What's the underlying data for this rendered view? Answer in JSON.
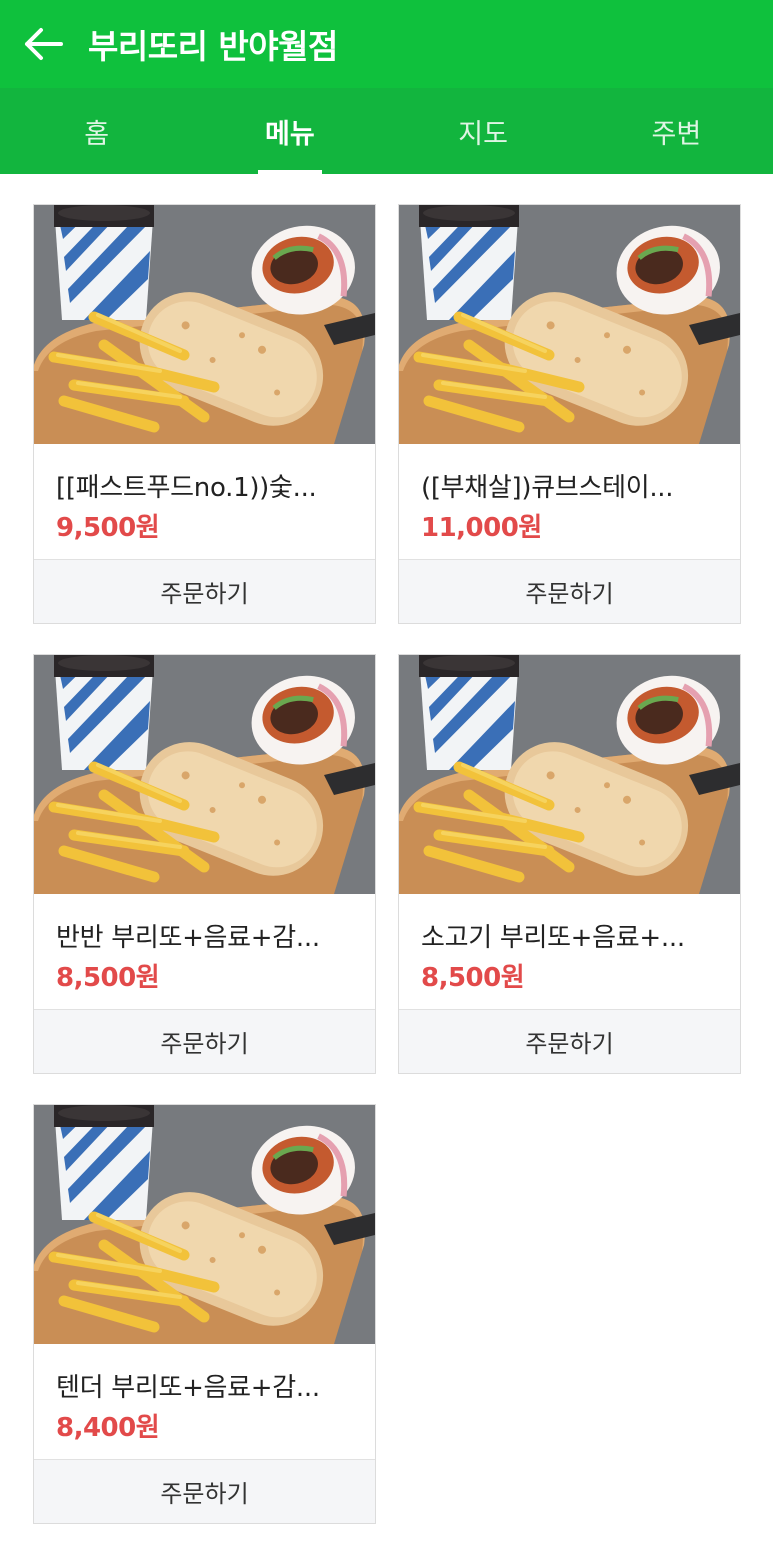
{
  "header": {
    "title": "부리또리 반야월점"
  },
  "tabs": [
    {
      "label": "홈"
    },
    {
      "label": "메뉴"
    },
    {
      "label": "지도"
    },
    {
      "label": "주변"
    }
  ],
  "active_tab": "메뉴",
  "menu_items": [
    {
      "name": "[[패스트푸드no.1))숯...",
      "price": "9,500원",
      "order_label": "주문하기"
    },
    {
      "name": "([부채살])큐브스테이...",
      "price": "11,000원",
      "order_label": "주문하기"
    },
    {
      "name": "반반 부리또+음료+감...",
      "price": "8,500원",
      "order_label": "주문하기"
    },
    {
      "name": "소고기 부리또+음료+...",
      "price": "8,500원",
      "order_label": "주문하기"
    },
    {
      "name": "텐더 부리또+음료+감...",
      "price": "8,400원",
      "order_label": "주문하기"
    }
  ],
  "colors": {
    "header": "#0fc13d",
    "tabs": "#12b53e",
    "price": "#e24a4a"
  },
  "icons": {
    "back": "arrow-left-icon"
  }
}
